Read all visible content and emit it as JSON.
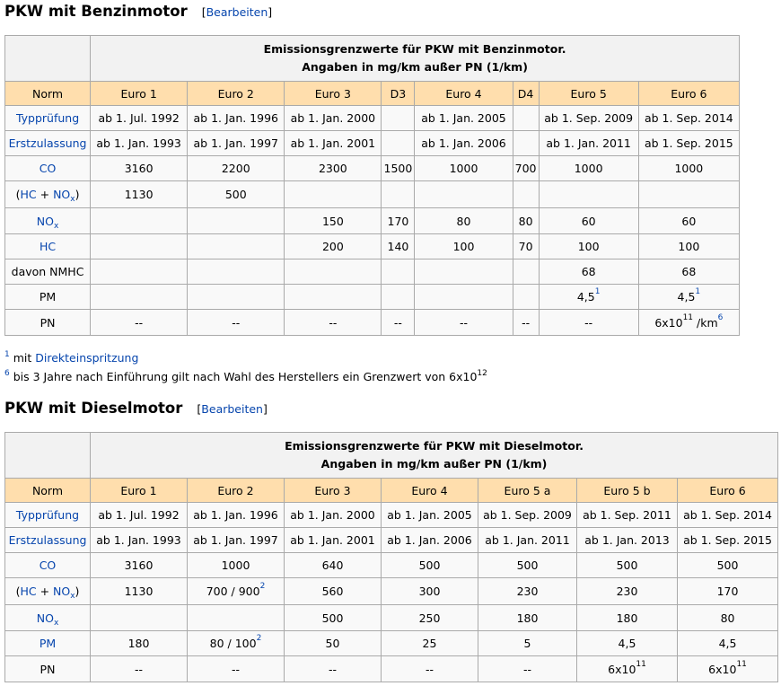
{
  "petrol": {
    "title": "PKW mit Benzinmotor",
    "edit_open": "[",
    "edit_label": "Bearbeiten",
    "edit_close": "]",
    "caption_line1": "Emissionsgrenzwerte für PKW mit Benzinmotor.",
    "caption_line2": "Angaben in mg/km außer PN (1/km)",
    "headers": [
      "Norm",
      "Euro 1",
      "Euro 2",
      "Euro 3",
      "D3",
      "Euro 4",
      "D4",
      "Euro 5",
      "Euro 6"
    ],
    "rows": {
      "typ": {
        "label": "Typprüfung",
        "cells": [
          "ab 1. Jul. 1992",
          "ab 1. Jan. 1996",
          "ab 1. Jan. 2000",
          "",
          "ab 1. Jan. 2005",
          "",
          "ab 1. Sep. 2009",
          "ab 1. Sep. 2014"
        ]
      },
      "erst": {
        "label": "Erstzulassung",
        "cells": [
          "ab 1. Jan. 1993",
          "ab 1. Jan. 1997",
          "ab 1. Jan. 2001",
          "",
          "ab 1. Jan. 2006",
          "",
          "ab 1. Jan. 2011",
          "ab 1. Sep. 2015"
        ]
      },
      "co": {
        "label": "CO",
        "cells": [
          "3160",
          "2200",
          "2300",
          "1500",
          "1000",
          "700",
          "1000",
          "1000"
        ]
      },
      "hcnox": {
        "open": "(",
        "hc": "HC",
        "plus": " + ",
        "no": "NO",
        "x": "x",
        "close": ")",
        "cells": [
          "1130",
          "500",
          "",
          "",
          "",
          "",
          "",
          ""
        ]
      },
      "nox": {
        "no": "NO",
        "x": "x",
        "cells": [
          "",
          "",
          "150",
          "170",
          "80",
          "80",
          "60",
          "60"
        ]
      },
      "hc": {
        "label": "HC",
        "cells": [
          "",
          "",
          "200",
          "140",
          "100",
          "70",
          "100",
          "100"
        ]
      },
      "nmhc": {
        "label": "davon NMHC",
        "cells": [
          "",
          "",
          "",
          "",
          "",
          "",
          "68",
          "68"
        ]
      },
      "pm": {
        "label": "PM",
        "cells": [
          "",
          "",
          "",
          "",
          "",
          "",
          "4,5",
          "4,5"
        ],
        "sup7": "1",
        "sup8": "1"
      },
      "pn": {
        "label": "PN",
        "cells": [
          "--",
          "--",
          "--",
          "--",
          "--",
          "--",
          "--"
        ],
        "euro6_base": "6x10",
        "euro6_exp": "11",
        "euro6_unit": " /km",
        "euro6_note": "6"
      }
    },
    "notes": [
      {
        "num": "1",
        "text": " mit ",
        "link": "Direkteinspritzung",
        "after": "",
        "exp": ""
      },
      {
        "num": "6",
        "text": " bis 3 Jahre nach Einführung gilt nach Wahl des Herstellers ein Grenzwert von 6x10",
        "link": "",
        "after": "",
        "exp": "12"
      }
    ]
  },
  "diesel": {
    "title": "PKW mit Dieselmotor",
    "edit_open": "[",
    "edit_label": "Bearbeiten",
    "edit_close": "]",
    "caption_line1": "Emissionsgrenzwerte für PKW mit Dieselmotor.",
    "caption_line2": "Angaben in mg/km außer PN (1/km)",
    "headers": [
      "Norm",
      "Euro 1",
      "Euro 2",
      "Euro 3",
      "Euro 4",
      "Euro 5 a",
      "Euro 5 b",
      "Euro 6"
    ],
    "rows": {
      "typ": {
        "label": "Typprüfung",
        "cells": [
          "ab 1. Jul. 1992",
          "ab 1. Jan. 1996",
          "ab 1. Jan. 2000",
          "ab 1. Jan. 2005",
          "ab 1. Sep. 2009",
          "ab 1. Sep. 2011",
          "ab 1. Sep. 2014"
        ]
      },
      "erst": {
        "label": "Erstzulassung",
        "cells": [
          "ab 1. Jan. 1993",
          "ab 1. Jan. 1997",
          "ab 1. Jan. 2001",
          "ab 1. Jan. 2006",
          "ab 1. Jan. 2011",
          "ab 1. Jan. 2013",
          "ab 1. Sep. 2015"
        ]
      },
      "co": {
        "label": "CO",
        "cells": [
          "3160",
          "1000",
          "640",
          "500",
          "500",
          "500",
          "500"
        ]
      },
      "hcnox": {
        "open": "(",
        "hc": "HC",
        "plus": " + ",
        "no": "NO",
        "x": "x",
        "close": ")",
        "cells": [
          "1130",
          "700 / 900",
          "560",
          "300",
          "230",
          "230",
          "170"
        ],
        "sup2": "2"
      },
      "nox": {
        "no": "NO",
        "x": "x",
        "cells": [
          "",
          "",
          "500",
          "250",
          "180",
          "180",
          "80"
        ]
      },
      "pm": {
        "label": "PM",
        "cells": [
          "180",
          "80 / 100",
          "50",
          "25",
          "5",
          "4,5",
          "4,5"
        ],
        "sup2": "2"
      },
      "pn": {
        "label": "PN",
        "cells": [
          "--",
          "--",
          "--",
          "--",
          "--"
        ],
        "base": "6x10",
        "exp": "11"
      }
    }
  }
}
